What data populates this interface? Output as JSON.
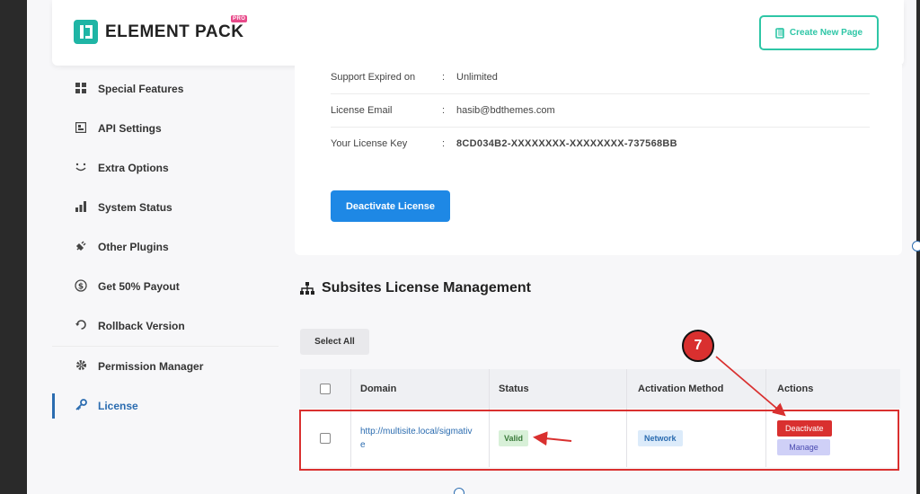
{
  "header": {
    "logo_text": "ELEMENT PACK",
    "pro_badge": "PRO",
    "create_button": "Create New Page"
  },
  "sidebar": {
    "items": [
      {
        "label": "Special Features",
        "icon": "grid-icon"
      },
      {
        "label": "API Settings",
        "icon": "api-icon"
      },
      {
        "label": "Extra Options",
        "icon": "smile-icon"
      },
      {
        "label": "System Status",
        "icon": "bar-chart-icon"
      },
      {
        "label": "Other Plugins",
        "icon": "plug-icon"
      },
      {
        "label": "Get 50% Payout",
        "icon": "dollar-icon"
      },
      {
        "label": "Rollback Version",
        "icon": "rollback-icon"
      },
      {
        "label": "Permission Manager",
        "icon": "gear-icon"
      },
      {
        "label": "License",
        "icon": "key-icon",
        "active": true
      }
    ]
  },
  "license": {
    "rows": [
      {
        "label": "Support Expired on",
        "value": "Unlimited"
      },
      {
        "label": "License Email",
        "value": "hasib@bdthemes.com"
      },
      {
        "label": "Your License Key",
        "value": "8CD034B2-XXXXXXXX-XXXXXXXX-737568BB"
      }
    ],
    "colon": ":",
    "deactivate_button": "Deactivate License"
  },
  "subsites": {
    "title": "Subsites License Management",
    "select_all": "Select All",
    "columns": [
      "Domain",
      "Status",
      "Activation Method",
      "Actions"
    ],
    "rows": [
      {
        "domain": "http://multisite.local/sigmative",
        "status": "Valid",
        "method": "Network",
        "actions": [
          "Deactivate",
          "Manage"
        ]
      }
    ]
  },
  "annotation": {
    "step_number": "7"
  },
  "colors": {
    "accent": "#1e88e5",
    "brand": "#1fb5a5",
    "danger": "#d9302f",
    "active_nav": "#2b6cb0"
  }
}
